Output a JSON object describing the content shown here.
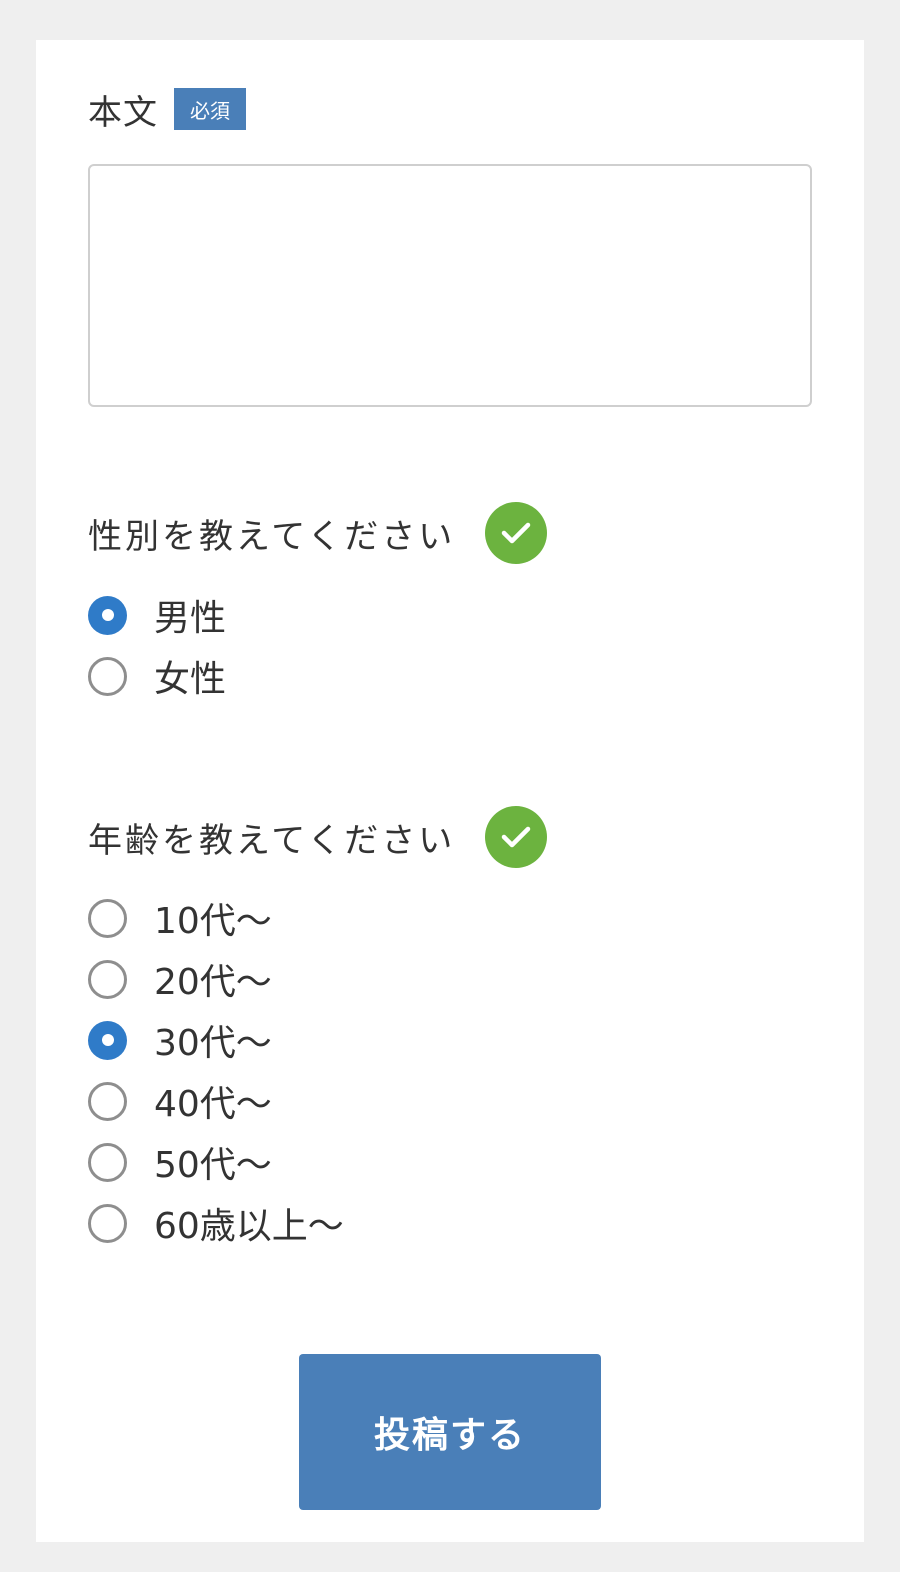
{
  "form": {
    "body_field": {
      "label": "本文",
      "required_badge": "必須",
      "value": "",
      "placeholder": ""
    },
    "gender_question": {
      "label": "性別を教えてください",
      "status_icon": "check-circle-icon",
      "options": [
        {
          "label": "男性",
          "checked": true
        },
        {
          "label": "女性",
          "checked": false
        }
      ]
    },
    "age_question": {
      "label": "年齢を教えてください",
      "status_icon": "check-circle-icon",
      "options": [
        {
          "label": "10代〜",
          "checked": false
        },
        {
          "label": "20代〜",
          "checked": false
        },
        {
          "label": "30代〜",
          "checked": true
        },
        {
          "label": "40代〜",
          "checked": false
        },
        {
          "label": "50代〜",
          "checked": false
        },
        {
          "label": "60歳以上〜",
          "checked": false
        }
      ]
    },
    "submit_label": "投稿する"
  },
  "colors": {
    "accent": "#4a7fb8",
    "radio_checked": "#2f7bc8",
    "success": "#6cb33f",
    "background": "#efefef"
  }
}
